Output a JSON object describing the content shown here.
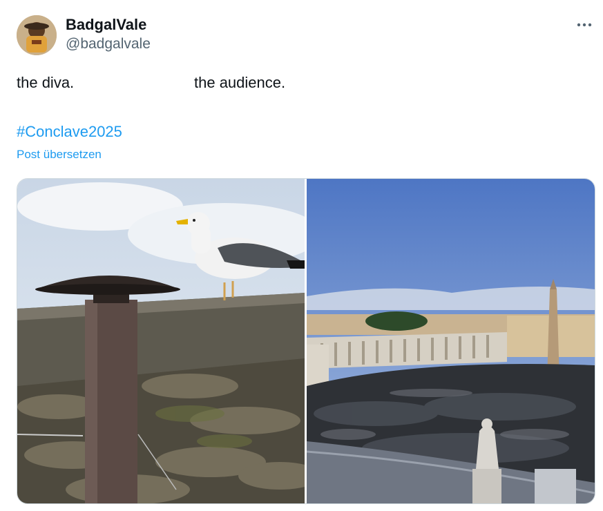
{
  "user": {
    "display_name": "BadgalVale",
    "handle": "@badgalvale"
  },
  "post": {
    "text_left": "the diva.",
    "text_right": "the audience.",
    "hashtag": "#Conclave2025",
    "translate_label": "Post übersetzen"
  },
  "icons": {
    "more": "more-options-icon"
  },
  "colors": {
    "link": "#1d9bf0",
    "text": "#0f1419",
    "secondary": "#536471",
    "border": "#cfd9de"
  },
  "media": [
    {
      "alt": "seagull on roof next to chimney"
    },
    {
      "alt": "crowd in St. Peter's Square"
    }
  ]
}
